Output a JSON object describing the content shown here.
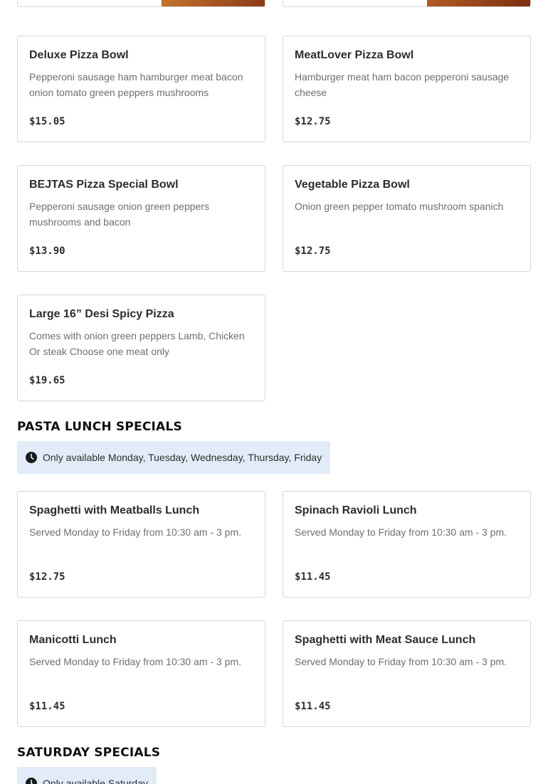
{
  "partial_cards": [
    {
      "price": "$"
    },
    {
      "price": "$"
    }
  ],
  "pizza_bowls": [
    {
      "title": "Deluxe Pizza Bowl",
      "description": "Pepperoni sausage ham hamburger meat bacon onion tomato green peppers mushrooms",
      "price": "$15.05"
    },
    {
      "title": "MeatLover Pizza Bowl",
      "description": "Hamburger meat ham bacon pepperoni sausage cheese",
      "price": "$12.75"
    },
    {
      "title": "BEJTAS Pizza Special Bowl",
      "description": "Pepperoni sausage onion green peppers mushrooms and bacon",
      "price": "$13.90"
    },
    {
      "title": "Vegetable Pizza Bowl",
      "description": "Onion green pepper tomato mushroom spanich",
      "price": "$12.75"
    },
    {
      "title": "Large 16” Desi Spicy Pizza",
      "description": "Comes with onion green peppers Lamb, Chicken Or steak Choose one meat only",
      "price": "$19.65"
    }
  ],
  "pasta_section": {
    "heading": "PASTA LUNCH SPECIALS",
    "availability": "Only available Monday, Tuesday, Wednesday, Thursday, Friday",
    "items": [
      {
        "title": "Spaghetti with Meatballs Lunch",
        "description": "Served Monday to Friday from 10:30 am - 3 pm.",
        "price": "$12.75"
      },
      {
        "title": "Spinach Ravioli Lunch",
        "description": "Served Monday to Friday from 10:30 am - 3 pm.",
        "price": "$11.45"
      },
      {
        "title": "Manicotti Lunch",
        "description": "Served Monday to Friday from 10:30 am - 3 pm.",
        "price": "$11.45"
      },
      {
        "title": "Spaghetti with Meat Sauce Lunch",
        "description": "Served Monday to Friday from 10:30 am - 3 pm.",
        "price": "$11.45"
      }
    ]
  },
  "saturday_section": {
    "heading": "SATURDAY SPECIALS",
    "availability": "Only available Saturday"
  },
  "icons": {
    "availability_icon": "clock-icon"
  },
  "colors": {
    "availability_bg": "#e2ecf8",
    "card_border": "#d6d6d6"
  }
}
